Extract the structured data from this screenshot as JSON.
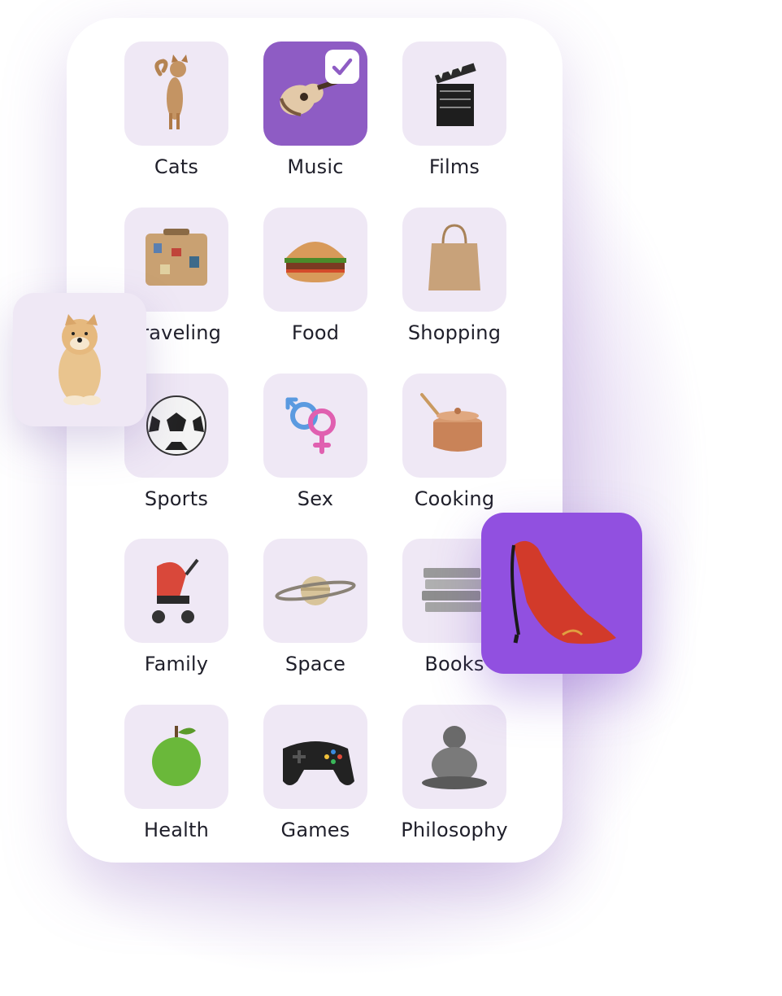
{
  "categories": [
    {
      "label": "Cats",
      "icon": "cat-icon",
      "selected": false
    },
    {
      "label": "Music",
      "icon": "guitar-icon",
      "selected": true
    },
    {
      "label": "Films",
      "icon": "clapperboard-icon",
      "selected": false
    },
    {
      "label": "Traveling",
      "icon": "suitcase-icon",
      "selected": false
    },
    {
      "label": "Food",
      "icon": "burger-icon",
      "selected": false
    },
    {
      "label": "Shopping",
      "icon": "shopping-bag-icon",
      "selected": false
    },
    {
      "label": "Sports",
      "icon": "soccer-ball-icon",
      "selected": false
    },
    {
      "label": "Sex",
      "icon": "gender-symbols-icon",
      "selected": false
    },
    {
      "label": "Cooking",
      "icon": "cooking-pot-icon",
      "selected": false
    },
    {
      "label": "Family",
      "icon": "stroller-icon",
      "selected": false
    },
    {
      "label": "Space",
      "icon": "saturn-icon",
      "selected": false
    },
    {
      "label": "Books",
      "icon": "books-icon",
      "selected": false
    },
    {
      "label": "Health",
      "icon": "apple-icon",
      "selected": false
    },
    {
      "label": "Games",
      "icon": "gamepad-icon",
      "selected": false
    },
    {
      "label": "Philosophy",
      "icon": "buddha-statue-icon",
      "selected": false
    }
  ],
  "floating": {
    "dog": {
      "icon": "doge-dog-icon"
    },
    "shoe": {
      "icon": "high-heel-shoe-icon"
    }
  },
  "colors": {
    "tile_bg": "#efe8f5",
    "selected_bg": "#8e5cc4",
    "accent_purple": "#9150e0",
    "check_color": "#8e5cc4"
  }
}
